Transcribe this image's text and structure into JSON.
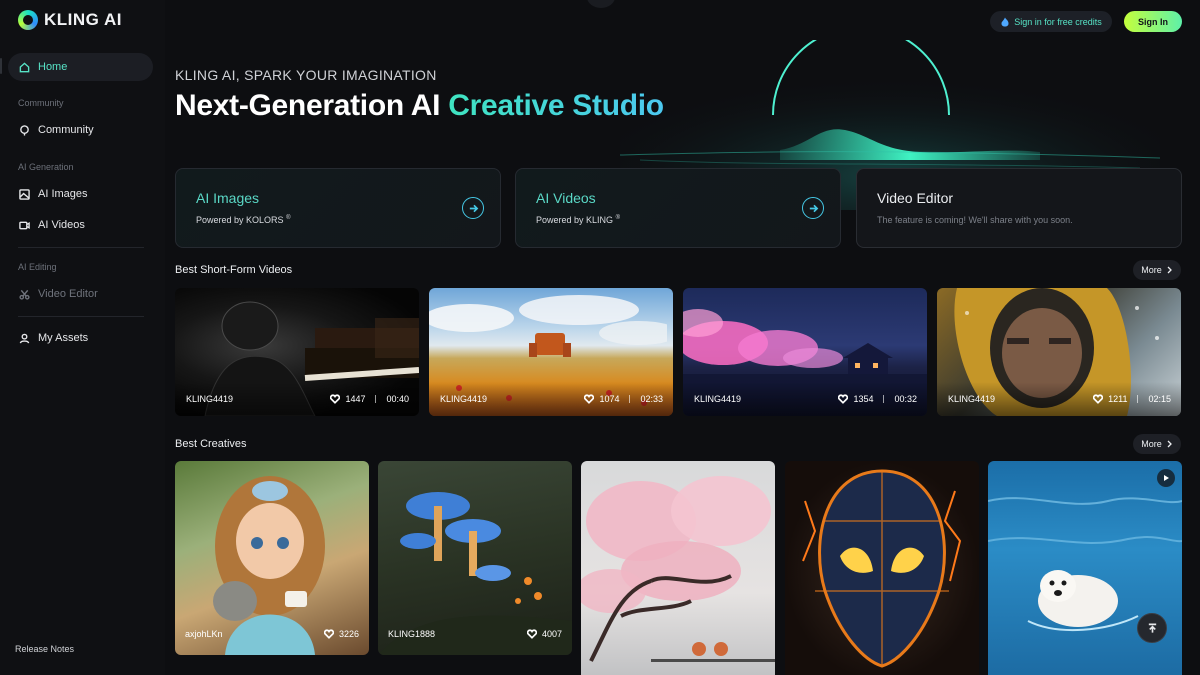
{
  "brand": {
    "name": "KLING AI"
  },
  "header": {
    "credits_label": "Sign in for free credits",
    "signin_label": "Sign In"
  },
  "sidebar": {
    "home": "Home",
    "community_section": "Community",
    "community": "Community",
    "ai_generation_section": "AI Generation",
    "ai_images": "AI Images",
    "ai_videos": "AI Videos",
    "ai_editing_section": "AI Editing",
    "video_editor": "Video Editor",
    "my_assets": "My Assets",
    "release_notes": "Release Notes"
  },
  "hero": {
    "tagline": "KLING AI, SPARK YOUR IMAGINATION",
    "title_main": "Next-Generation AI ",
    "title_accent": "Creative Studio"
  },
  "features": [
    {
      "title": "AI Images",
      "subtitle": "Powered by KOLORS",
      "mark": "®"
    },
    {
      "title": "AI Videos",
      "subtitle": "Powered by KLING",
      "mark": "®"
    },
    {
      "title": "Video Editor",
      "subtitle": "The feature is coming! We'll share with you soon."
    }
  ],
  "short_videos": {
    "title": "Best Short-Form Videos",
    "more": "More",
    "items": [
      {
        "author": "KLING4419",
        "likes": "1447",
        "duration": "00:40"
      },
      {
        "author": "KLING4419",
        "likes": "1074",
        "duration": "02:33"
      },
      {
        "author": "KLING4419",
        "likes": "1354",
        "duration": "00:32"
      },
      {
        "author": "KLING4419",
        "likes": "1211",
        "duration": "02:15"
      }
    ]
  },
  "creatives": {
    "title": "Best Creatives",
    "more": "More",
    "items": [
      {
        "author": "axjohLKn",
        "likes": "3226"
      },
      {
        "author": "KLING1888",
        "likes": "4007"
      }
    ]
  },
  "colors": {
    "accent": "#57e3c6",
    "signin_start": "#c4ff3c",
    "signin_end": "#5ef0a9"
  }
}
